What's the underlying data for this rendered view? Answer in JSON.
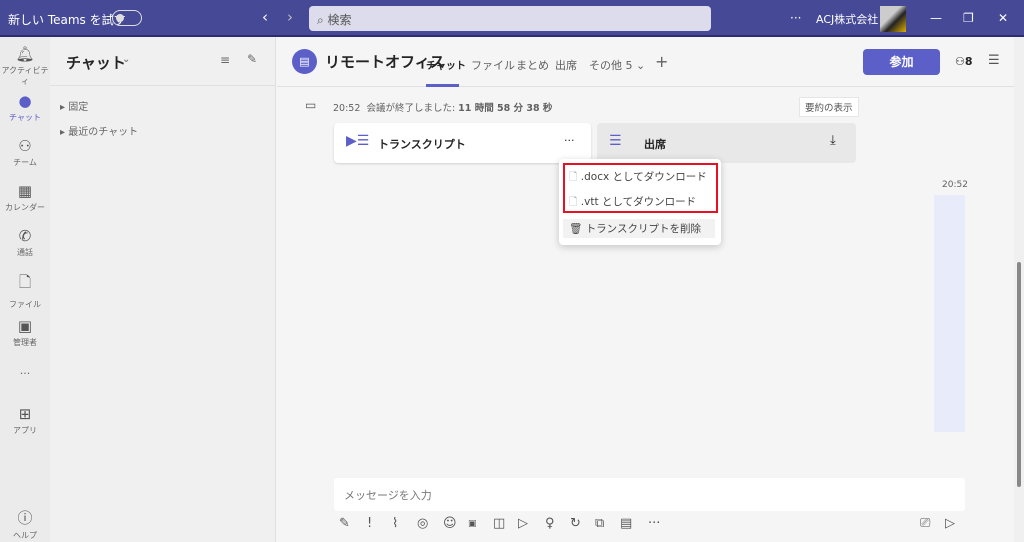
{
  "titlebar": {
    "try_new": "新しい Teams を試す",
    "search_placeholder": "検索",
    "more": "···",
    "org": "ACJ株式会社"
  },
  "rail": [
    {
      "icon": "bell",
      "label": "アクティビティ"
    },
    {
      "icon": "chat",
      "label": "チャット"
    },
    {
      "icon": "teams",
      "label": "チーム"
    },
    {
      "icon": "calendar",
      "label": "カレンダー"
    },
    {
      "icon": "phone",
      "label": "通話"
    },
    {
      "icon": "file",
      "label": "ファイル"
    },
    {
      "icon": "admin",
      "label": "管理者"
    },
    {
      "icon": "more",
      "label": "···"
    },
    {
      "icon": "apps",
      "label": "アプリ"
    },
    {
      "icon": "help",
      "label": "ヘルプ"
    }
  ],
  "chatlist": {
    "title": "チャット",
    "sections": [
      "固定",
      "最近のチャット"
    ]
  },
  "header": {
    "title": "リモートオフィス",
    "tabs": [
      "チャット",
      "ファイル",
      "まとめ",
      "出席",
      "その他 5"
    ],
    "join": "参加",
    "participants": "8"
  },
  "message": {
    "time": "20:52",
    "text": "会議が終了しました: ",
    "duration": "11 時間 58 分 38 秒",
    "summary_btn": "要約の表示",
    "cards": [
      {
        "label": "トランスクリプト",
        "more": "···"
      },
      {
        "label": "出席"
      }
    ],
    "right_time": "20:52"
  },
  "menu": {
    "items": [
      ".docx としてダウンロード",
      ".vtt としてダウンロード",
      "トランスクリプトを削除"
    ],
    "highlight": "#e81123"
  },
  "compose": {
    "placeholder": "メッセージを入力"
  }
}
